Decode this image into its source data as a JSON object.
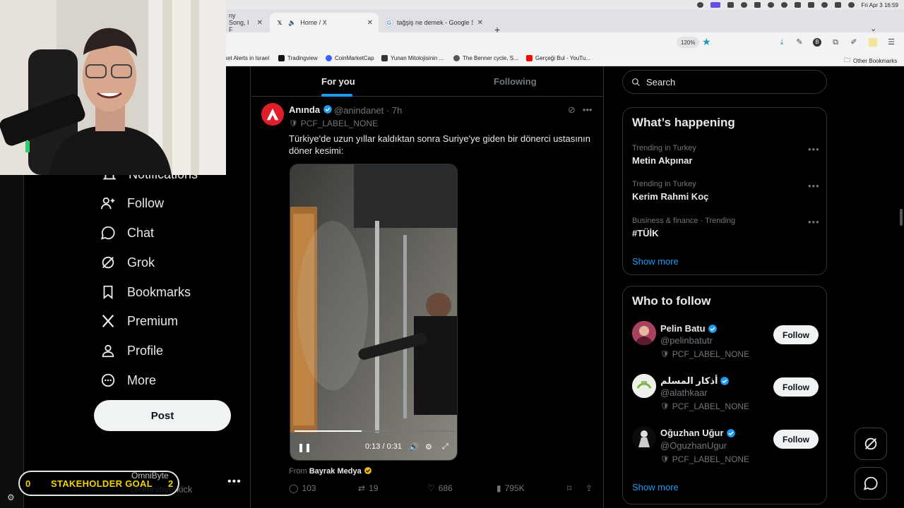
{
  "menubar": {
    "clock": "Fri Apr 3  16:59"
  },
  "browser": {
    "tabs": [
      {
        "label": "ny Song, I F",
        "active": false
      },
      {
        "label": "Home / X",
        "active": true
      },
      {
        "label": "tağşiş ne demek - Google Search",
        "active": false
      }
    ],
    "zoom": "120%",
    "bookmarks": [
      "ket Alerts in Israel",
      "Tradingview",
      "CoinMarketCap",
      "Yunan Mitolojisinin ...",
      "The Benner cycle, S...",
      "Gerçeği Bul - YouTu..."
    ],
    "other_bookmarks": "Other Bookmarks"
  },
  "nav": {
    "peek_item": "Notifications",
    "items": [
      "Follow",
      "Chat",
      "Grok",
      "Bookmarks",
      "Premium",
      "Profile",
      "More"
    ],
    "post_label": "Post",
    "account_handle": "@omnibytekick"
  },
  "feed": {
    "tabs": {
      "for_you": "For you",
      "following": "Following"
    },
    "tweet": {
      "name": "Anında",
      "handle_time": "@anindanet · 7h",
      "label": "PCF_LABEL_NONE",
      "text": "Türkiye'de uzun yıllar kaldıktan sonra Suriye'ye giden bir dönerci ustasının döner kesimi:",
      "video_time": "0:13 / 0:31",
      "video_progress": 0.42,
      "from_prefix": "From",
      "from_source": "Bayrak Medya",
      "stats": {
        "replies": "103",
        "reposts": "19",
        "likes": "686",
        "views": "795K"
      }
    }
  },
  "right": {
    "search_placeholder": "Search",
    "happening": {
      "title": "What’s happening",
      "trends": [
        {
          "category": "Trending in Turkey",
          "name": "Metin Akpınar"
        },
        {
          "category": "Trending in Turkey",
          "name": "Kerim Rahmi Koç"
        },
        {
          "category": "Business & finance · Trending",
          "name": "#TÜİK"
        }
      ],
      "show_more": "Show more"
    },
    "who_to_follow": {
      "title": "Who to follow",
      "accounts": [
        {
          "name": "Pelin Batu",
          "handle": "@pelinbatutr",
          "label": "PCF_LABEL_NONE",
          "button": "Follow"
        },
        {
          "name": "أذكار المسلم",
          "handle": "@alathkaar",
          "label": "PCF_LABEL_NONE",
          "button": "Follow"
        },
        {
          "name": "Oğuzhan Uğur",
          "handle": "@OguzhanUgur",
          "label": "PCF_LABEL_NONE",
          "button": "Follow"
        }
      ],
      "show_more": "Show more"
    }
  },
  "overlay": {
    "goal_left": "0",
    "goal_text": "STAKEHOLDER GOAL",
    "goal_right": "2",
    "streamer_name": "OmniByte"
  },
  "colors": {
    "accent": "#1d9bf0",
    "goal": "#f3d400",
    "brand_red": "#e01e2b"
  }
}
